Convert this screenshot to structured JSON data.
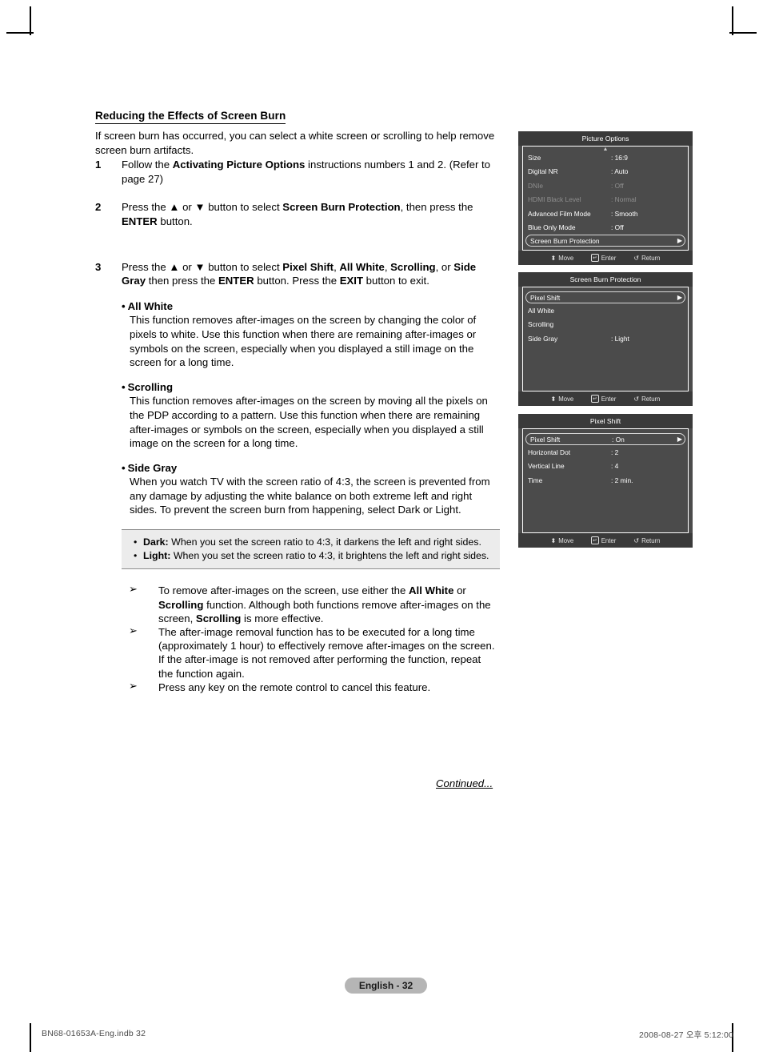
{
  "document": {
    "section_title": "Reducing the Effects of Screen Burn",
    "intro": "If screen burn has occurred, you can select a white screen or scrolling to help remove screen burn artifacts.",
    "steps": [
      {
        "num": "1",
        "parts": [
          {
            "t": "Follow the ",
            "b": false
          },
          {
            "t": "Activating Picture Options",
            "b": true
          },
          {
            "t": " instructions numbers 1 and 2. (Refer to page 27)",
            "b": false
          }
        ]
      },
      {
        "num": "2",
        "parts": [
          {
            "t": "Press the ▲ or ▼ button to select ",
            "b": false
          },
          {
            "t": "Screen Burn Protection",
            "b": true
          },
          {
            "t": ", then press the ",
            "b": false
          },
          {
            "t": "ENTER",
            "b": true
          },
          {
            "t": " button.",
            "b": false
          }
        ]
      },
      {
        "num": "3",
        "parts": [
          {
            "t": "Press the ▲ or ▼ button to select ",
            "b": false
          },
          {
            "t": "Pixel Shift",
            "b": true
          },
          {
            "t": ", ",
            "b": false
          },
          {
            "t": "All White",
            "b": true
          },
          {
            "t": ", ",
            "b": false
          },
          {
            "t": "Scrolling",
            "b": true
          },
          {
            "t": ", or ",
            "b": false
          },
          {
            "t": "Side Gray",
            "b": true
          },
          {
            "t": " then press the ",
            "b": false
          },
          {
            "t": "ENTER",
            "b": true
          },
          {
            "t": " button. Press the ",
            "b": false
          },
          {
            "t": "EXIT",
            "b": true
          },
          {
            "t": " button to exit.",
            "b": false
          }
        ]
      }
    ],
    "feature_bullets": [
      {
        "bullet": "•",
        "title": "All White",
        "body": "This function removes after-images on the screen by changing the color of pixels to white. Use this function when there are remaining after-images or symbols on the screen, especially when you displayed a still image on the screen for a long time."
      },
      {
        "bullet": "•",
        "title": "Scrolling",
        "body": "This function removes after-images on the screen by moving all the pixels on the PDP according to a pattern. Use this function when there are remaining after-images or symbols on the screen, especially when you displayed a still image on the screen for a long time."
      },
      {
        "bullet": "•",
        "title": "Side Gray",
        "body": "When you watch TV with the screen ratio of 4:3, the screen is prevented from any damage by adjusting the white balance on both extreme left and right sides. To prevent the screen burn from happening, select Dark or Light."
      }
    ],
    "notebox": [
      {
        "dot": "•",
        "label": "Dark:",
        "text": " When you set the screen ratio to 4:3, it darkens the left and right sides."
      },
      {
        "dot": "•",
        "label": "Light:",
        "text": " When you set the screen ratio to 4:3, it brightens the left and right sides."
      }
    ],
    "arrow_notes": [
      {
        "marker": "➢",
        "parts": [
          {
            "t": "To remove after-images on the screen, use either the ",
            "b": false
          },
          {
            "t": "All White",
            "b": true
          },
          {
            "t": " or ",
            "b": false
          },
          {
            "t": "Scrolling",
            "b": true
          },
          {
            "t": " function. Although both functions remove after-images on the screen, ",
            "b": false
          },
          {
            "t": "Scrolling",
            "b": true
          },
          {
            "t": " is more effective.",
            "b": false
          }
        ]
      },
      {
        "marker": "➢",
        "parts": [
          {
            "t": "The after-image removal function has to be executed for a long time (approximately 1 hour) to effectively remove after-images on the screen. If the after-image is not removed after performing the function, repeat the function again.",
            "b": false
          }
        ]
      },
      {
        "marker": "➢",
        "parts": [
          {
            "t": "Press any key on the remote control to cancel this feature.",
            "b": false
          }
        ]
      }
    ],
    "continued": "Continued...",
    "page_badge": "English - 32",
    "printer_left": "BN68-01653A-Eng.indb   32",
    "printer_right": "2008-08-27   오후 5:12:00"
  },
  "osd_footer": {
    "move_glyph": "⬍",
    "move_label": "Move",
    "enter_glyph": "↵",
    "enter_label": "Enter",
    "return_glyph": "↺",
    "return_label": "Return"
  },
  "osd_panels": [
    {
      "title": "Picture Options",
      "scroll_up": "▲",
      "rows": [
        {
          "label": "Size",
          "value": ": 16:9",
          "state": "normal",
          "arrow": ""
        },
        {
          "label": "Digital NR",
          "value": ": Auto",
          "state": "normal",
          "arrow": ""
        },
        {
          "label": "DNIe",
          "value": ": Off",
          "state": "dim",
          "arrow": ""
        },
        {
          "label": "HDMI Black Level",
          "value": ": Normal",
          "state": "dim",
          "arrow": ""
        },
        {
          "label": "Advanced Film Mode",
          "value": ": Smooth",
          "state": "normal",
          "arrow": ""
        },
        {
          "label": "Blue Only Mode",
          "value": ": Off",
          "state": "normal",
          "arrow": ""
        },
        {
          "label": "Screen Burn Protection",
          "value": "",
          "state": "selected",
          "arrow": "▶"
        }
      ],
      "spacers": 0
    },
    {
      "title": "Screen Burn Protection",
      "scroll_up": "",
      "rows": [
        {
          "label": "Pixel Shift",
          "value": "",
          "state": "selected",
          "arrow": "▶"
        },
        {
          "label": "All White",
          "value": "",
          "state": "normal",
          "arrow": ""
        },
        {
          "label": "Scrolling",
          "value": "",
          "state": "normal",
          "arrow": ""
        },
        {
          "label": "Side Gray",
          "value": ": Light",
          "state": "normal",
          "arrow": ""
        }
      ],
      "spacers": 3
    },
    {
      "title": "Pixel Shift",
      "scroll_up": "",
      "rows": [
        {
          "label": "Pixel Shift",
          "value": ": On",
          "state": "selected",
          "arrow": "▶"
        },
        {
          "label": "Horizontal Dot",
          "value": ": 2",
          "state": "normal",
          "arrow": ""
        },
        {
          "label": "Vertical Line",
          "value": ": 4",
          "state": "normal",
          "arrow": ""
        },
        {
          "label": "Time",
          "value": ": 2 min.",
          "state": "normal",
          "arrow": ""
        }
      ],
      "spacers": 3
    }
  ]
}
